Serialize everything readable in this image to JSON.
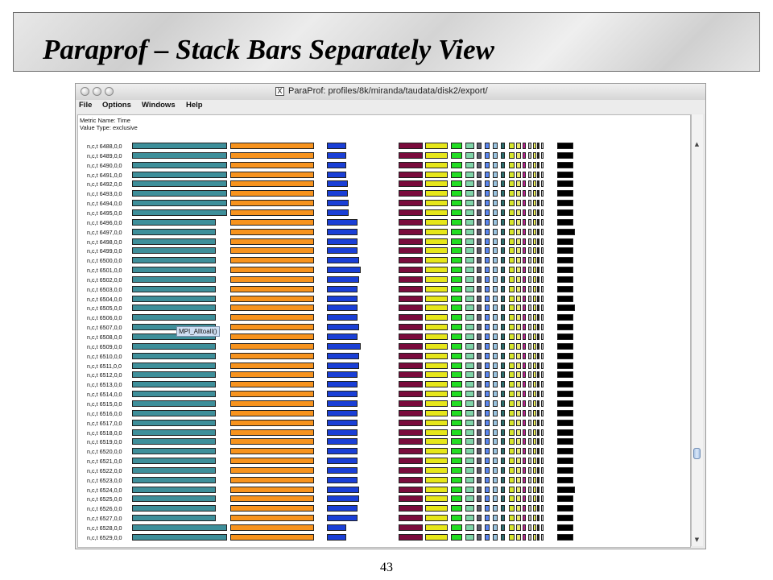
{
  "slide": {
    "title": "Paraprof – Stack Bars Separately View",
    "page_number": "43"
  },
  "window": {
    "title": "ParaProf: profiles/8k/miranda/taudata/disk2/export/",
    "menus": [
      "File",
      "Options",
      "Windows",
      "Help"
    ],
    "metric_name": "Metric Name: Time",
    "value_type": "Value Type: exclusive",
    "tooltip": "MPI_Alltoall()"
  },
  "rows": [
    "n,c,t 6488,0,0",
    "n,c,t 6489,0,0",
    "n,c,t 6490,0,0",
    "n,c,t 6491,0,0",
    "n,c,t 6492,0,0",
    "n,c,t 6493,0,0",
    "n,c,t 6494,0,0",
    "n,c,t 6495,0,0",
    "n,c,t 6496,0,0",
    "n,c,t 6497,0,0",
    "n,c,t 6498,0,0",
    "n,c,t 6499,0,0",
    "n,c,t 6500,0,0",
    "n,c,t 6501,0,0",
    "n,c,t 6502,0,0",
    "n,c,t 6503,0,0",
    "n,c,t 6504,0,0",
    "n,c,t 6505,0,0",
    "n,c,t 6506,0,0",
    "n,c,t 6507,0,0",
    "n,c,t 6508,0,0",
    "n,c,t 6509,0,0",
    "n,c,t 6510,0,0",
    "n,c,t 6511,0,0",
    "n,c,t 6512,0,0",
    "n,c,t 6513,0,0",
    "n,c,t 6514,0,0",
    "n,c,t 6515,0,0",
    "n,c,t 6516,0,0",
    "n,c,t 6517,0,0",
    "n,c,t 6518,0,0",
    "n,c,t 6519,0,0",
    "n,c,t 6520,0,0",
    "n,c,t 6521,0,0",
    "n,c,t 6522,0,0",
    "n,c,t 6523,0,0",
    "n,c,t 6524,0,0",
    "n,c,t 6525,0,0",
    "n,c,t 6526,0,0",
    "n,c,t 6527,0,0",
    "n,c,t 6528,0,0",
    "n,c,t 6529,0,0"
  ],
  "columns": [
    {
      "color": "#3e8f9a",
      "values": [
        118,
        118,
        118,
        118,
        118,
        118,
        118,
        118,
        104,
        104,
        104,
        104,
        104,
        104,
        104,
        104,
        104,
        104,
        104,
        104,
        104,
        104,
        104,
        104,
        104,
        104,
        104,
        104,
        104,
        104,
        104,
        104,
        104,
        104,
        104,
        104,
        104,
        104,
        104,
        104,
        118,
        118
      ]
    },
    {
      "color": "#f7931e",
      "values": [
        104,
        104,
        104,
        104,
        104,
        104,
        104,
        104,
        104,
        104,
        104,
        104,
        104,
        104,
        104,
        104,
        104,
        104,
        104,
        104,
        104,
        104,
        104,
        104,
        104,
        104,
        104,
        104,
        104,
        104,
        104,
        104,
        104,
        104,
        104,
        104,
        104,
        104,
        104,
        104,
        104,
        104
      ]
    },
    {
      "color": "#1a3fd6",
      "values": [
        24,
        24,
        24,
        24,
        26,
        26,
        27,
        27,
        38,
        38,
        38,
        38,
        40,
        42,
        40,
        38,
        38,
        38,
        38,
        40,
        38,
        42,
        40,
        40,
        38,
        38,
        38,
        38,
        38,
        38,
        38,
        38,
        38,
        38,
        38,
        38,
        40,
        40,
        38,
        38,
        24,
        24
      ]
    },
    {
      "color": "#7a0b3c",
      "values": [
        30,
        30,
        30,
        30,
        30,
        30,
        30,
        30,
        30,
        30,
        30,
        30,
        30,
        30,
        30,
        30,
        30,
        30,
        30,
        30,
        30,
        30,
        30,
        30,
        30,
        30,
        30,
        30,
        30,
        30,
        30,
        30,
        30,
        30,
        30,
        30,
        30,
        30,
        30,
        30,
        30,
        30
      ]
    },
    {
      "color": "#e6e61a",
      "values": [
        28,
        28,
        28,
        28,
        28,
        28,
        28,
        28,
        28,
        28,
        28,
        28,
        28,
        28,
        28,
        28,
        28,
        28,
        28,
        28,
        28,
        28,
        28,
        28,
        28,
        28,
        28,
        28,
        28,
        28,
        28,
        28,
        28,
        28,
        28,
        28,
        28,
        28,
        28,
        28,
        28,
        28
      ]
    },
    {
      "color": "#22dd22",
      "values": [
        14,
        14,
        14,
        14,
        14,
        14,
        14,
        14,
        14,
        14,
        14,
        14,
        14,
        14,
        14,
        14,
        14,
        14,
        14,
        14,
        14,
        14,
        14,
        14,
        14,
        14,
        14,
        14,
        14,
        14,
        14,
        14,
        14,
        14,
        14,
        14,
        14,
        14,
        14,
        14,
        14,
        14
      ]
    },
    {
      "color": "#7fd4a8",
      "values": [
        11,
        11,
        11,
        11,
        11,
        11,
        11,
        11,
        11,
        11,
        11,
        11,
        11,
        11,
        11,
        11,
        11,
        11,
        11,
        11,
        11,
        11,
        11,
        11,
        11,
        11,
        11,
        11,
        11,
        11,
        11,
        11,
        11,
        11,
        11,
        11,
        11,
        11,
        11,
        11,
        11,
        11
      ]
    },
    {
      "color": "#5a5a6a",
      "values": [
        6,
        6,
        6,
        6,
        6,
        6,
        6,
        6,
        6,
        6,
        6,
        6,
        6,
        6,
        6,
        6,
        6,
        6,
        6,
        6,
        6,
        6,
        6,
        6,
        6,
        6,
        6,
        6,
        6,
        6,
        6,
        6,
        6,
        6,
        6,
        6,
        6,
        6,
        6,
        6,
        6,
        6
      ]
    },
    {
      "color": "#5a86f0",
      "values": [
        6,
        6,
        6,
        6,
        6,
        6,
        6,
        6,
        6,
        6,
        6,
        6,
        6,
        6,
        6,
        6,
        6,
        6,
        6,
        6,
        6,
        6,
        6,
        6,
        6,
        6,
        6,
        6,
        6,
        6,
        6,
        6,
        6,
        6,
        6,
        6,
        6,
        6,
        6,
        6,
        6,
        6
      ]
    },
    {
      "color": "#9ac4e0",
      "values": [
        6,
        6,
        6,
        6,
        6,
        6,
        6,
        6,
        6,
        6,
        6,
        6,
        6,
        6,
        6,
        6,
        6,
        6,
        6,
        6,
        6,
        6,
        6,
        6,
        6,
        6,
        6,
        6,
        6,
        6,
        6,
        6,
        6,
        6,
        6,
        6,
        6,
        6,
        6,
        6,
        6,
        6
      ]
    },
    {
      "color": "#2b6e6e",
      "values": [
        5,
        5,
        5,
        5,
        5,
        5,
        5,
        5,
        5,
        5,
        5,
        5,
        5,
        5,
        5,
        5,
        5,
        5,
        5,
        5,
        5,
        5,
        5,
        5,
        5,
        5,
        5,
        5,
        5,
        5,
        5,
        5,
        5,
        5,
        5,
        5,
        5,
        5,
        5,
        5,
        5,
        5
      ]
    },
    {
      "color": "#d6e62a",
      "values": [
        7,
        7,
        7,
        7,
        7,
        7,
        7,
        7,
        7,
        7,
        7,
        7,
        7,
        7,
        7,
        7,
        7,
        7,
        7,
        7,
        7,
        7,
        7,
        7,
        7,
        7,
        7,
        7,
        7,
        7,
        7,
        7,
        7,
        7,
        7,
        7,
        7,
        7,
        7,
        7,
        7,
        7
      ]
    },
    {
      "color": "#e8e86a",
      "values": [
        6,
        6,
        6,
        6,
        6,
        6,
        6,
        6,
        6,
        6,
        6,
        6,
        6,
        6,
        6,
        6,
        6,
        6,
        6,
        6,
        6,
        6,
        6,
        6,
        6,
        6,
        6,
        6,
        6,
        6,
        6,
        6,
        6,
        6,
        6,
        6,
        6,
        6,
        6,
        6,
        6,
        6
      ]
    },
    {
      "color": "#c02090",
      "values": [
        4,
        4,
        4,
        4,
        4,
        4,
        4,
        4,
        4,
        4,
        4,
        4,
        4,
        4,
        4,
        4,
        4,
        4,
        4,
        4,
        4,
        4,
        4,
        4,
        4,
        4,
        4,
        4,
        4,
        4,
        4,
        4,
        4,
        4,
        4,
        4,
        4,
        4,
        4,
        4,
        4,
        4
      ]
    },
    {
      "color": "#c0c0c0",
      "values": [
        4,
        4,
        4,
        4,
        4,
        4,
        4,
        4,
        4,
        4,
        4,
        4,
        4,
        4,
        4,
        4,
        4,
        4,
        4,
        4,
        4,
        4,
        4,
        4,
        4,
        4,
        4,
        4,
        4,
        4,
        4,
        4,
        4,
        4,
        4,
        4,
        4,
        4,
        4,
        4,
        4,
        4
      ]
    },
    {
      "color": "#f0f05a",
      "values": [
        4,
        4,
        4,
        4,
        4,
        4,
        4,
        4,
        4,
        4,
        4,
        4,
        4,
        4,
        4,
        4,
        4,
        4,
        4,
        4,
        4,
        4,
        4,
        4,
        4,
        4,
        4,
        4,
        4,
        4,
        4,
        4,
        4,
        4,
        4,
        4,
        4,
        4,
        4,
        4,
        4,
        4
      ]
    },
    {
      "color": "#1e1e1e",
      "values": [
        3,
        3,
        3,
        3,
        3,
        3,
        3,
        3,
        3,
        3,
        3,
        3,
        3,
        3,
        3,
        3,
        3,
        3,
        3,
        3,
        3,
        3,
        3,
        3,
        3,
        3,
        3,
        3,
        3,
        3,
        3,
        3,
        3,
        3,
        3,
        3,
        3,
        3,
        3,
        3,
        3,
        3
      ]
    },
    {
      "color": "#e0e0e0",
      "values": [
        3,
        3,
        3,
        3,
        3,
        3,
        3,
        3,
        3,
        3,
        3,
        3,
        3,
        3,
        3,
        3,
        3,
        3,
        3,
        3,
        3,
        3,
        3,
        3,
        3,
        3,
        3,
        3,
        3,
        3,
        3,
        3,
        3,
        3,
        3,
        3,
        3,
        3,
        3,
        3,
        3,
        3
      ]
    },
    {
      "color": "#000000",
      "values": [
        20,
        20,
        20,
        20,
        20,
        20,
        20,
        20,
        20,
        22,
        20,
        20,
        20,
        20,
        20,
        20,
        20,
        22,
        20,
        20,
        20,
        20,
        20,
        20,
        20,
        20,
        20,
        20,
        20,
        20,
        20,
        20,
        20,
        20,
        20,
        20,
        22,
        20,
        20,
        20,
        20,
        20
      ]
    }
  ]
}
